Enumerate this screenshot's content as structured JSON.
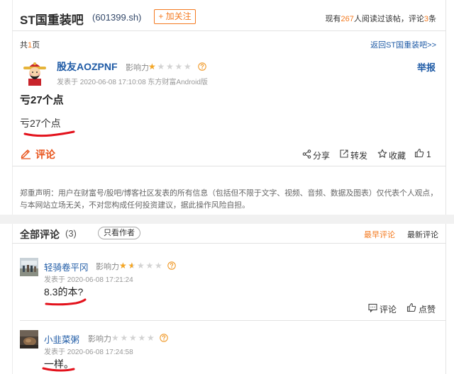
{
  "header": {
    "bar_name": "ST国重装吧",
    "stock_code": "(601399.sh)",
    "follow_label": "+ 加关注",
    "stats_prefix": "现有",
    "read_count": "267",
    "stats_middle": "人阅读过该帖，评论",
    "comment_count": "3",
    "stats_suffix": "条"
  },
  "pager": {
    "prefix": "共",
    "pages": "1",
    "suffix": "页",
    "back_link": "返回ST国重装吧>>"
  },
  "post": {
    "author": "股友AOZPNF",
    "influence_label": "影响力",
    "influence_stars": 1,
    "report_label": "举报",
    "meta": "发表于 2020-06-08 17:10:08 东方财富Android版",
    "title": "亏27个点",
    "body": "亏27个点",
    "comment_label": "评论",
    "actions": {
      "share": "分享",
      "forward": "转发",
      "favorite": "收藏",
      "like_count": "1"
    }
  },
  "disclaimer": "郑重声明：用户在财富号/股吧/博客社区发表的所有信息（包括但不限于文字、视频、音频、数据及图表）仅代表个人观点，与本网站立场无关，不对您构成任何投资建议，据此操作风险自担。",
  "comments_section": {
    "title": "全部评论",
    "count": "(3)",
    "author_only": "只看作者",
    "sort_earliest": "最早评论",
    "sort_latest": "最新评论"
  },
  "comments": [
    {
      "author": "轻骑卷平冈",
      "influence_label": "影响力",
      "influence_stars": 1.5,
      "meta": "发表于 2020-06-08 17:21:24",
      "body": "8.3的本?",
      "reply_label": "评论",
      "like_label": "点赞"
    },
    {
      "author": "小韭菜粥",
      "influence_label": "影响力",
      "influence_stars": 0,
      "meta": "发表于 2020-06-08 17:24:58",
      "body": "一样。"
    }
  ],
  "icons": [
    "question-circle-icon",
    "pencil-icon",
    "share-icon",
    "forward-icon",
    "star-outline-icon",
    "thumbs-up-icon",
    "comment-bubble-icon"
  ],
  "colors": {
    "accent": "#f47a20",
    "link": "#1f5ba6",
    "comment": "#e8541c",
    "annotation_red": "#e3121c",
    "star_on": "#f5a623",
    "star_off": "#d3d3d3"
  }
}
